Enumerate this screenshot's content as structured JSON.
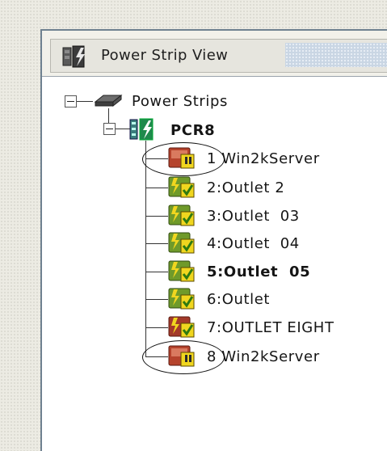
{
  "window": {
    "title": "Power Strip View"
  },
  "tree": {
    "root": {
      "label": "Power Strips"
    },
    "strip": {
      "label": "PCR8"
    },
    "outlets": [
      {
        "label": "1 Win2kServer",
        "state": "off",
        "highlighted": true
      },
      {
        "label": "2:Outlet 2",
        "state": "on",
        "highlighted": false
      },
      {
        "label": "3:Outlet  03",
        "state": "on",
        "highlighted": false
      },
      {
        "label": "4:Outlet  04",
        "state": "on",
        "highlighted": false
      },
      {
        "label": "5:Outlet  05",
        "state": "on",
        "highlighted": false
      },
      {
        "label": "6:Outlet",
        "state": "on",
        "highlighted": false
      },
      {
        "label": "7:OUTLET EIGHT",
        "state": "off",
        "highlighted": false
      },
      {
        "label": "8 Win2kServer",
        "state": "off",
        "highlighted": true
      }
    ]
  },
  "colors": {
    "on": "#6f9a2a",
    "off": "#a33a2a",
    "frame": "#6f8190"
  }
}
